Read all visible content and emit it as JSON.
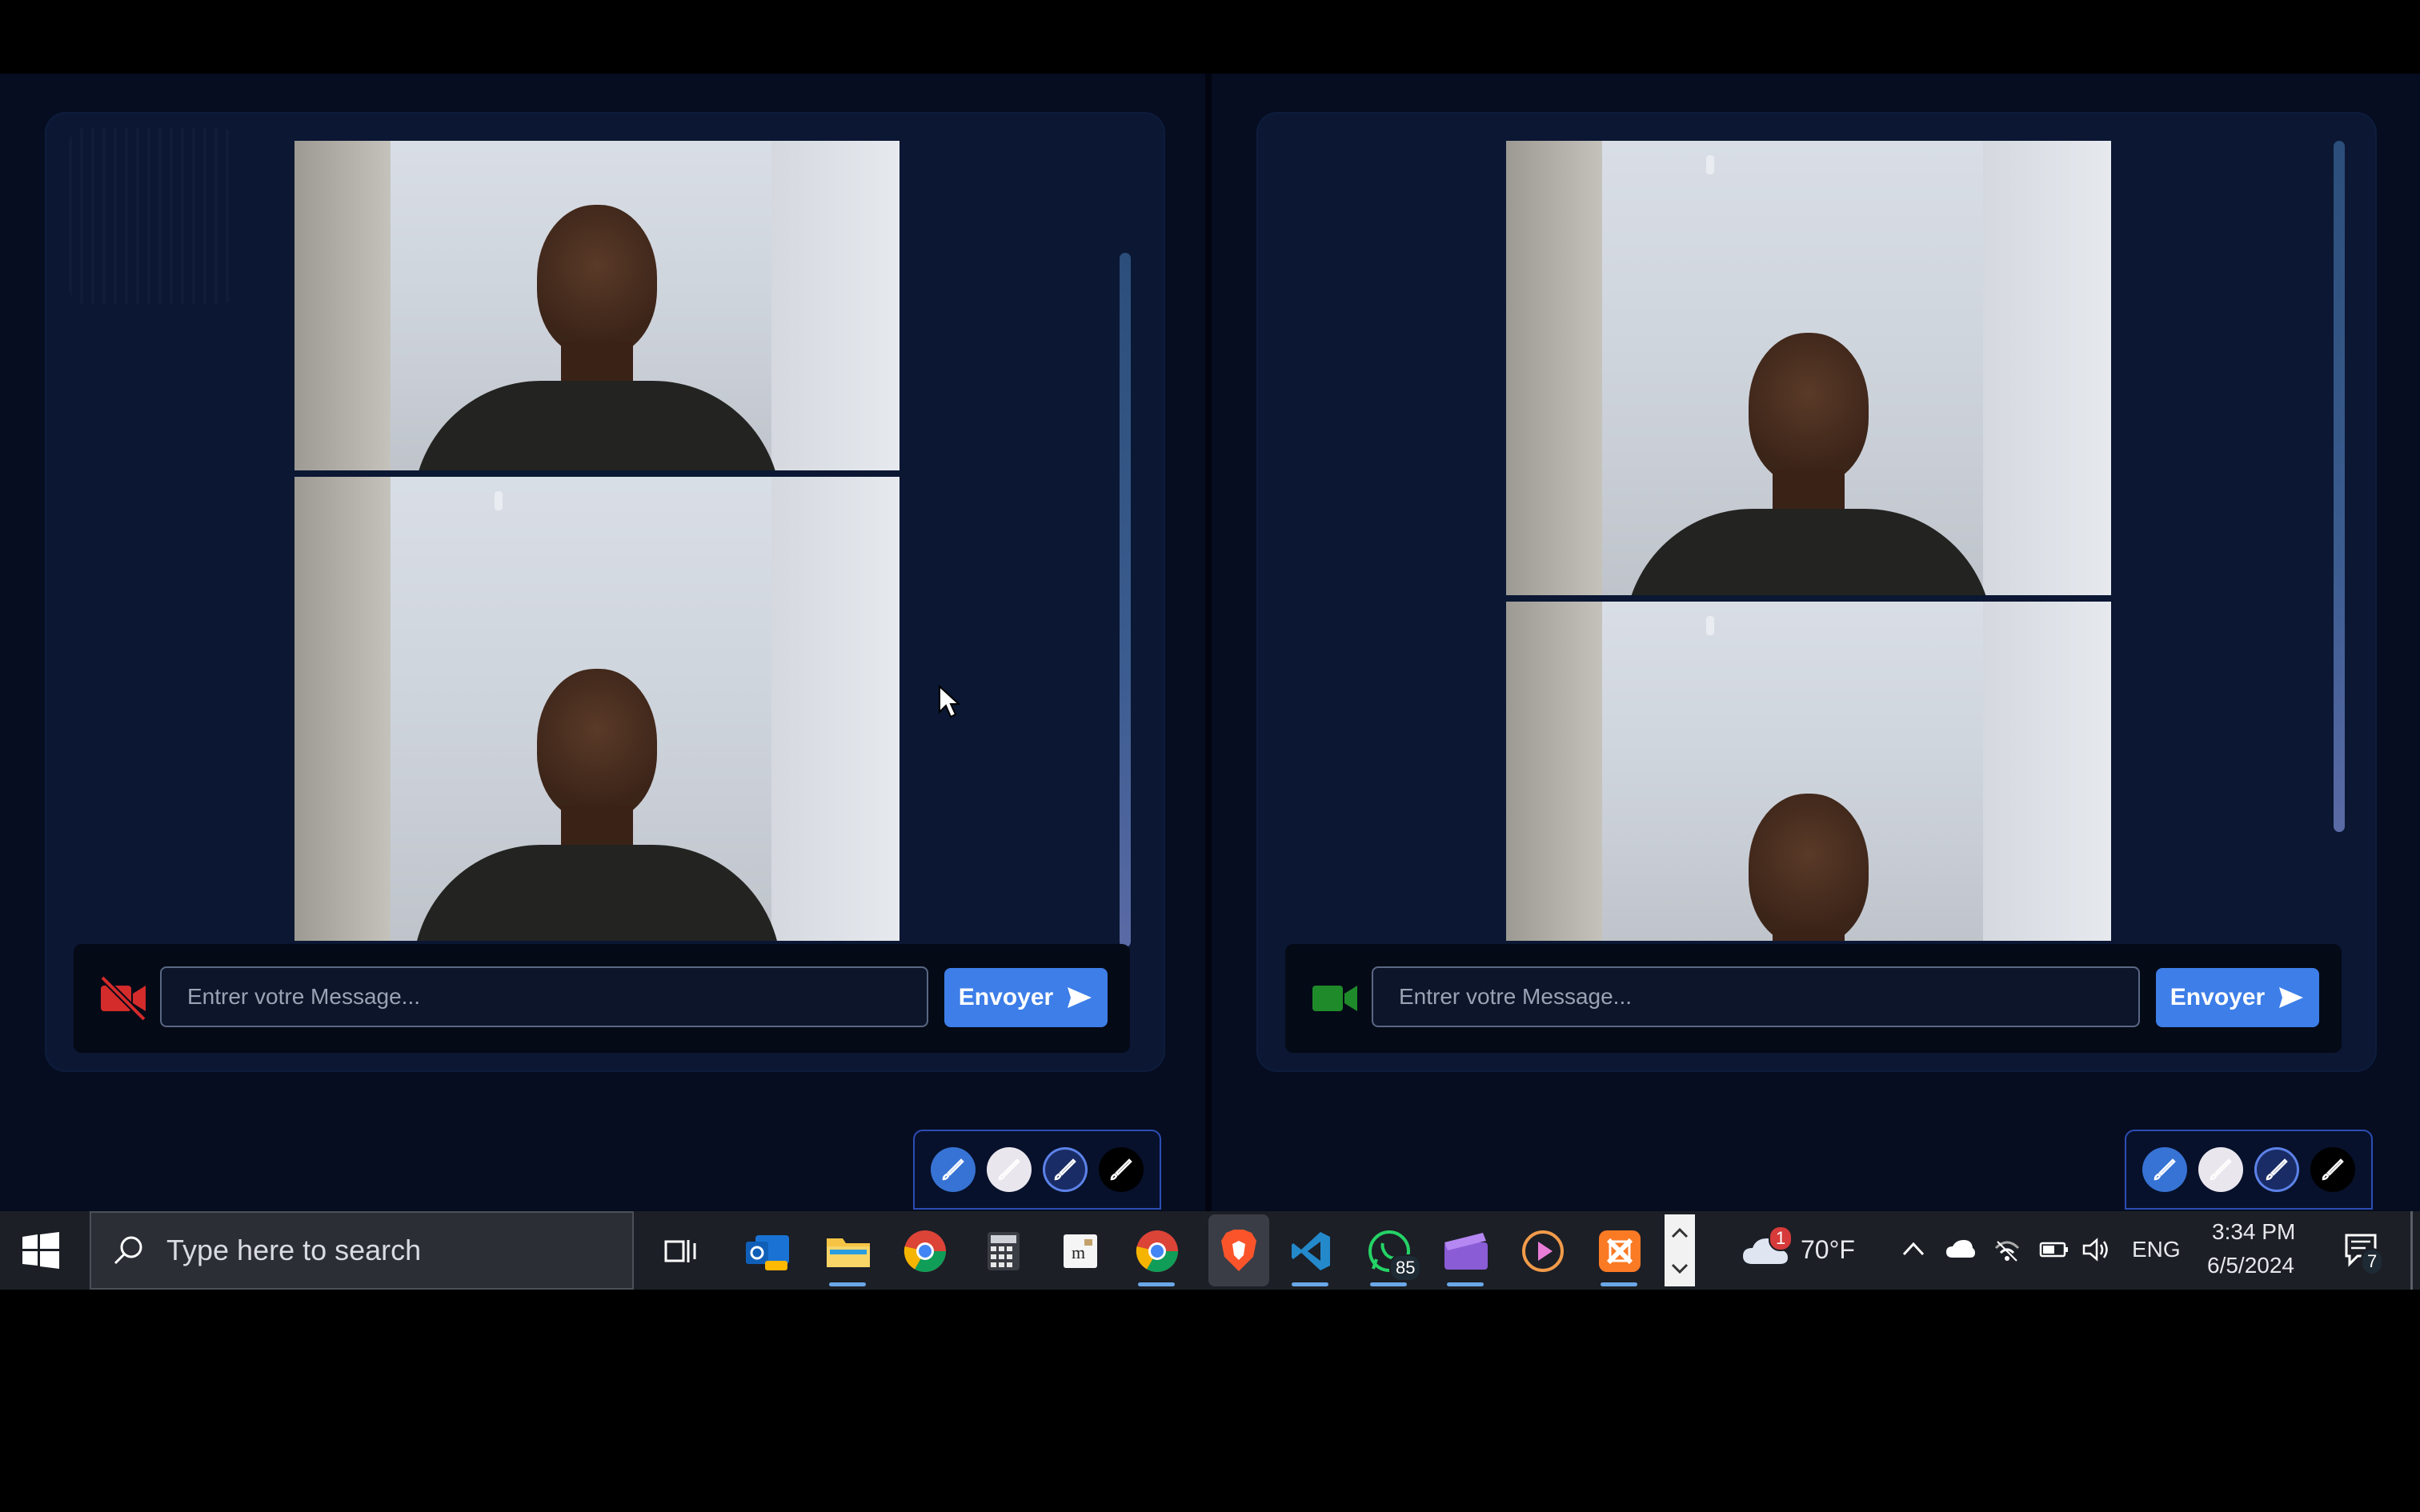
{
  "panels": [
    {
      "id": "left",
      "camera_state": "off",
      "camera_color": "#d42b2b",
      "message_placeholder": "Entrer votre Message...",
      "send_label": "Envoyer"
    },
    {
      "id": "right",
      "camera_state": "on",
      "camera_color": "#1f8a2a",
      "message_placeholder": "Entrer votre Message...",
      "send_label": "Envoyer"
    }
  ],
  "tools": [
    "brush-blue-icon",
    "brush-white-icon",
    "brush-outline-icon",
    "brush-black-icon"
  ],
  "taskbar": {
    "search_placeholder": "Type here to search",
    "apps": [
      "task-view",
      "outlook-new",
      "file-explorer",
      "chrome",
      "calculator",
      "notepad",
      "chrome",
      "brave",
      "vscode",
      "whatsapp",
      "clipchamp",
      "media-player",
      "xampp"
    ],
    "whatsapp_badge": "85",
    "weather_temp": "70°F",
    "weather_badge": "1",
    "language": "ENG",
    "time": "3:34 PM",
    "date": "6/5/2024",
    "notifications_count": "7"
  },
  "colors": {
    "accent": "#3d7ee8",
    "card_bg": "#0b1733",
    "page_bg": "#050b1c"
  }
}
